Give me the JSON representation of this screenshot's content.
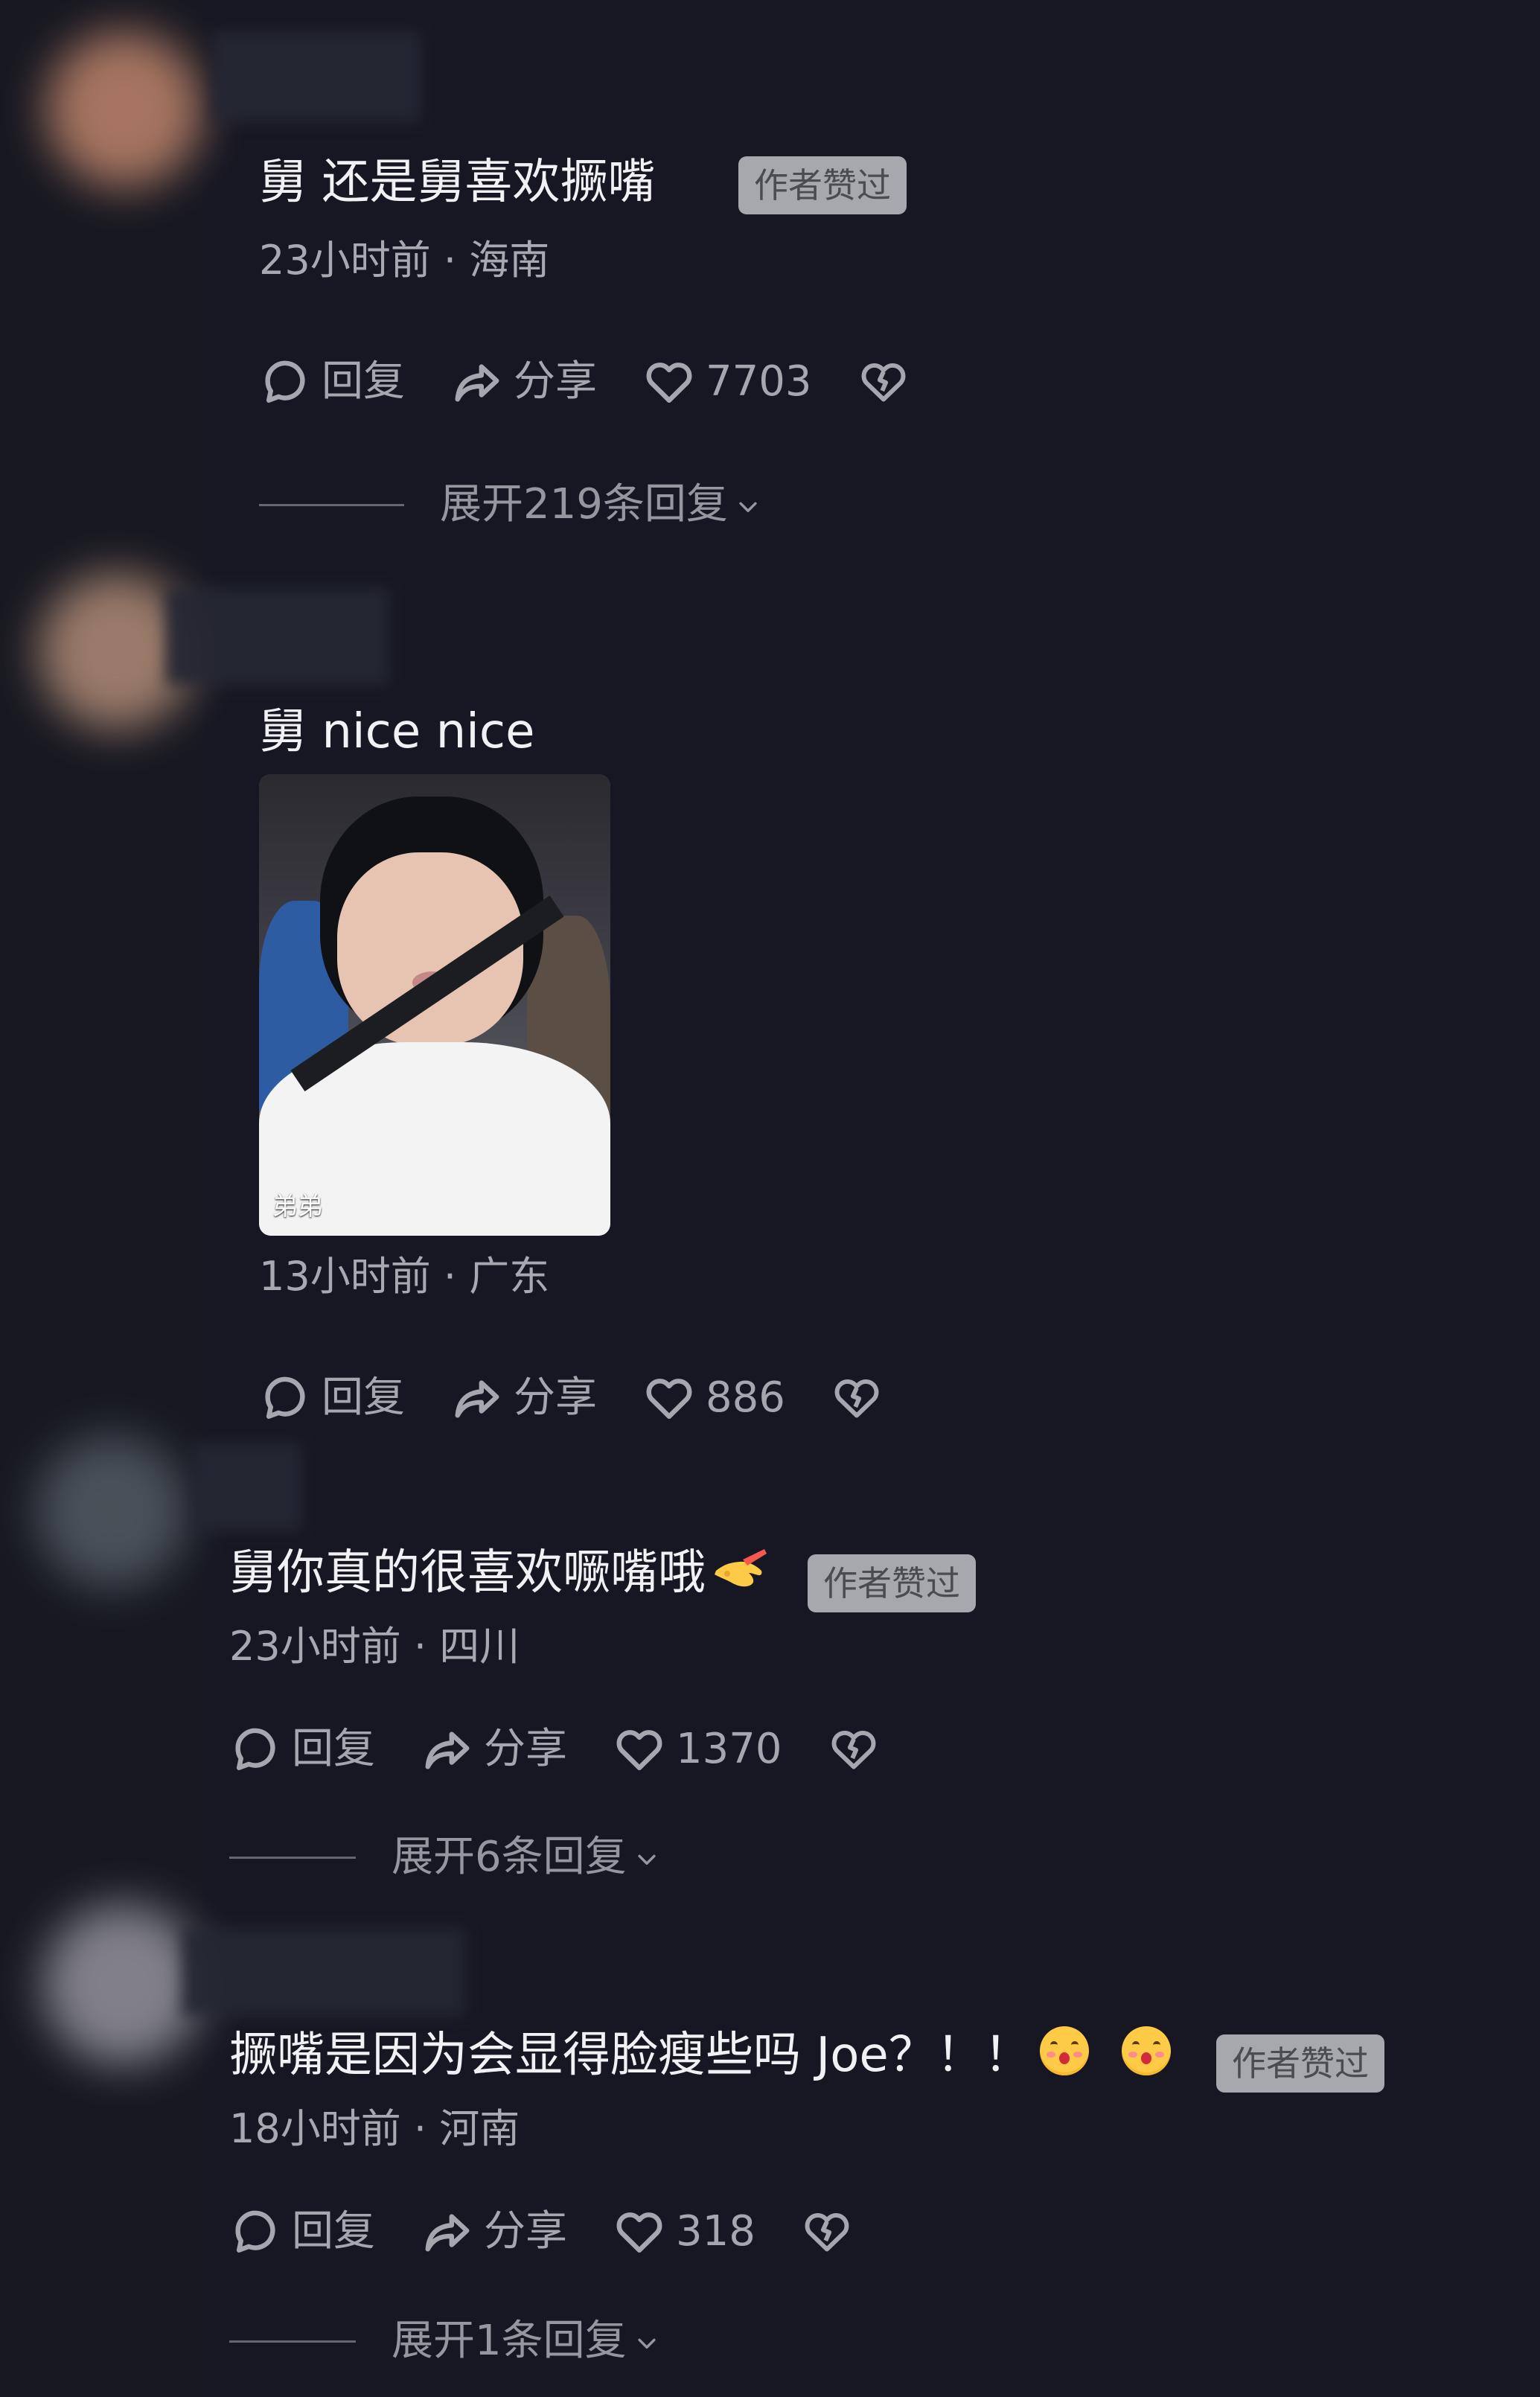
{
  "comments": [
    {
      "text": "舅 还是舅喜欢撅嘴",
      "badge": "作者赞过",
      "meta": "23小时前 · 海南",
      "reply_label": "回复",
      "share_label": "分享",
      "likes": "7703",
      "expand": "展开219条回复"
    },
    {
      "text": "舅 nice nice",
      "image_caption": "弟弟",
      "meta": "13小时前 · 广东",
      "reply_label": "回复",
      "share_label": "分享",
      "likes": "886"
    },
    {
      "text": "舅你真的很喜欢噘嘴哦",
      "badge": "作者赞过",
      "meta": "23小时前 · 四川",
      "reply_label": "回复",
      "share_label": "分享",
      "likes": "1370",
      "expand": "展开6条回复"
    },
    {
      "text": "撅嘴是因为会显得脸瘦些吗 Joe？！！",
      "badge": "作者赞过",
      "meta": "18小时前 · 河南",
      "reply_label": "回复",
      "share_label": "分享",
      "likes": "318",
      "expand": "展开1条回复"
    }
  ],
  "colors": {
    "background": "#161722",
    "text_primary": "#f1f1f3",
    "text_secondary": "#a8a9b0",
    "badge_bg": "#a7a8ae",
    "badge_text": "#4a4b53"
  },
  "icons": {
    "reply": "reply-icon",
    "share": "share-icon",
    "like": "heart-icon",
    "dislike": "broken-heart-icon",
    "expand": "chevron-down-icon"
  }
}
